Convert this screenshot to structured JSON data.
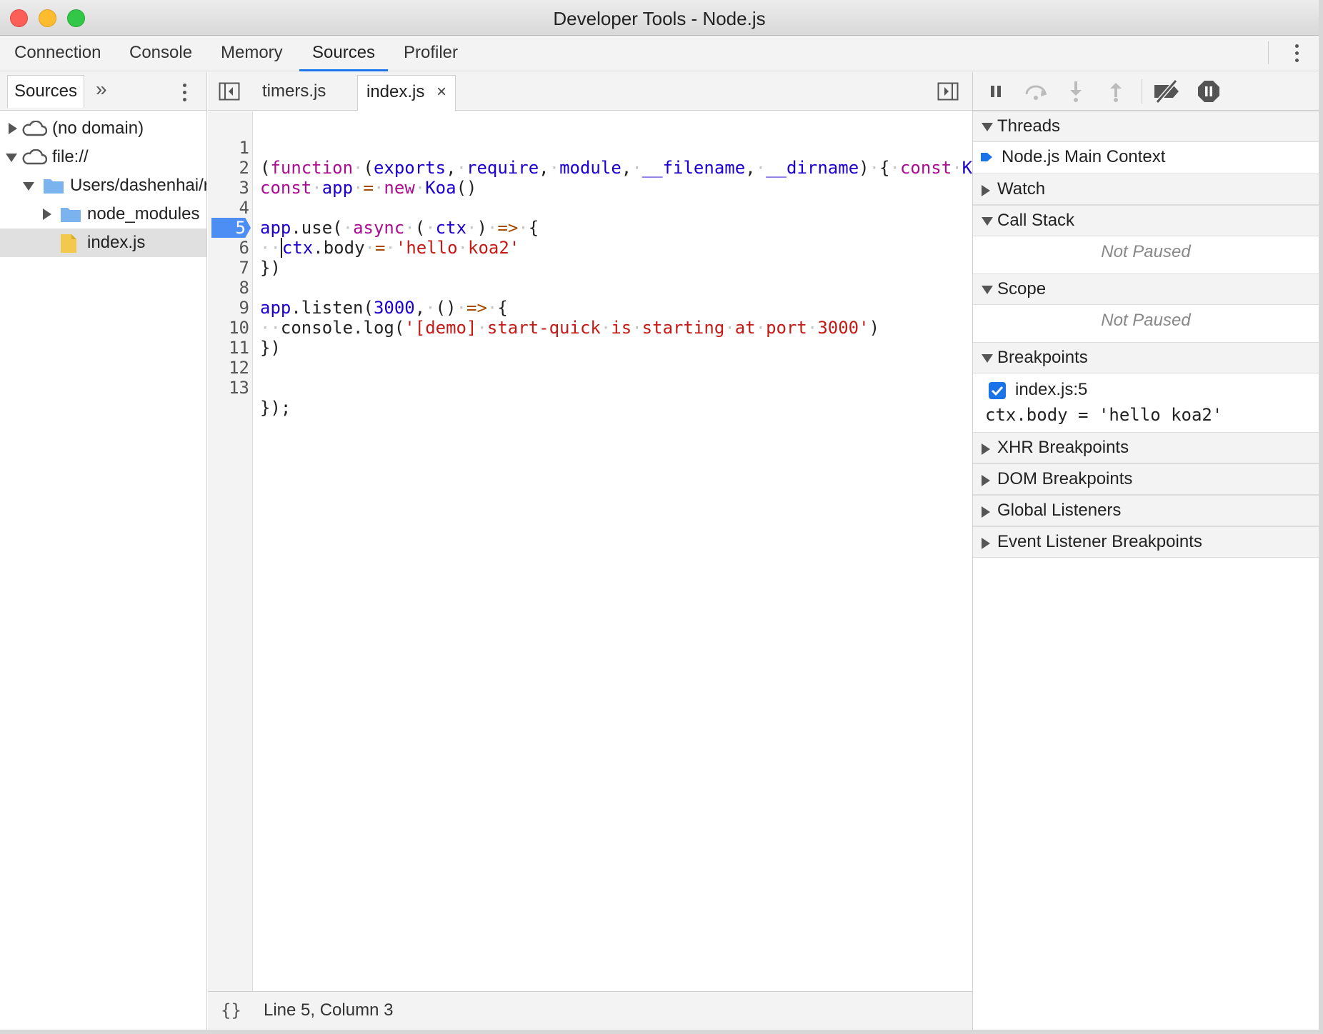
{
  "window": {
    "title": "Developer Tools - Node.js"
  },
  "main_tabs": [
    "Connection",
    "Console",
    "Memory",
    "Sources",
    "Profiler"
  ],
  "active_main_tab": "Sources",
  "navigator": {
    "tab_label": "Sources",
    "more_label": "»",
    "tree": [
      {
        "label": "(no domain)",
        "type": "domain"
      },
      {
        "label": "file://",
        "type": "domain"
      },
      {
        "label": "Users/dashenhai/r",
        "type": "folder"
      },
      {
        "label": "node_modules",
        "type": "folder"
      },
      {
        "label": "index.js",
        "type": "file"
      }
    ]
  },
  "editor": {
    "tabs": [
      {
        "label": "timers.js",
        "closable": false
      },
      {
        "label": "index.js",
        "closable": true
      }
    ],
    "close_glyph": "×",
    "breakpoint_line": 5,
    "line_numbers": [
      "1",
      "2",
      "3",
      "4",
      "5",
      "6",
      "7",
      "8",
      "9",
      "10",
      "11",
      "12",
      "13"
    ],
    "status": {
      "pretty_print": "{}",
      "cursor": "Line 5, Column 3"
    }
  },
  "debugger": {
    "threads": {
      "label": "Threads",
      "item": "Node.js Main Context"
    },
    "watch": {
      "label": "Watch"
    },
    "call_stack": {
      "label": "Call Stack",
      "status": "Not Paused"
    },
    "scope": {
      "label": "Scope",
      "status": "Not Paused"
    },
    "breakpoints": {
      "label": "Breakpoints",
      "item": {
        "location": "index.js:5",
        "code": "ctx.body = 'hello koa2'",
        "checked": true
      }
    },
    "xhr_breakpoints": {
      "label": "XHR Breakpoints"
    },
    "dom_breakpoints": {
      "label": "DOM Breakpoints"
    },
    "global_listeners": {
      "label": "Global Listeners"
    },
    "event_listener_breakpoints": {
      "label": "Event Listener Breakpoints"
    }
  },
  "colors": {
    "accent": "#1a73e8",
    "breakpoint": "#4d8ef5",
    "keyword": "#aa0d91",
    "string": "#c41a16",
    "identifier": "#1c00cf"
  }
}
